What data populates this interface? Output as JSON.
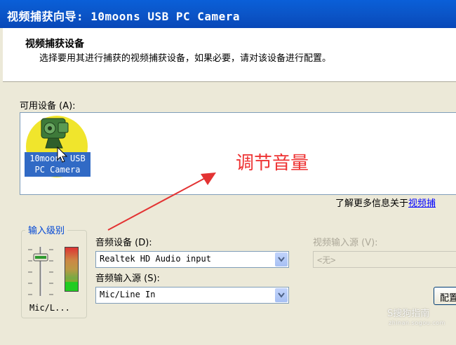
{
  "window": {
    "title": "视频捕获向导: 10moons USB PC Camera"
  },
  "header": {
    "title": "视频捕获设备",
    "subtitle": "选择要用其进行捕获的视频捕获设备，如果必要，请对该设备进行配置。"
  },
  "devices": {
    "label": "可用设备 (A):",
    "items": [
      {
        "line1": "10moons USB",
        "line2": "PC Camera"
      }
    ]
  },
  "annotation": {
    "text": "调节音量",
    "color": "#e33333"
  },
  "more_info": {
    "prefix": "了解更多信息关于",
    "link": "视频捕"
  },
  "input_level": {
    "title": "输入级别",
    "source_short": "Mic/L..."
  },
  "audio_device": {
    "label": "音频设备 (D):",
    "value": "Realtek HD Audio input"
  },
  "audio_source": {
    "label": "音频输入源 (S):",
    "value": "Mic/Line In"
  },
  "video_source": {
    "label": "视频输入源 (V):",
    "value": "<无>"
  },
  "config_button": {
    "label": "配置"
  },
  "watermark": {
    "text": "S搜狗指南",
    "sub": "zhinan.sogou.com"
  }
}
